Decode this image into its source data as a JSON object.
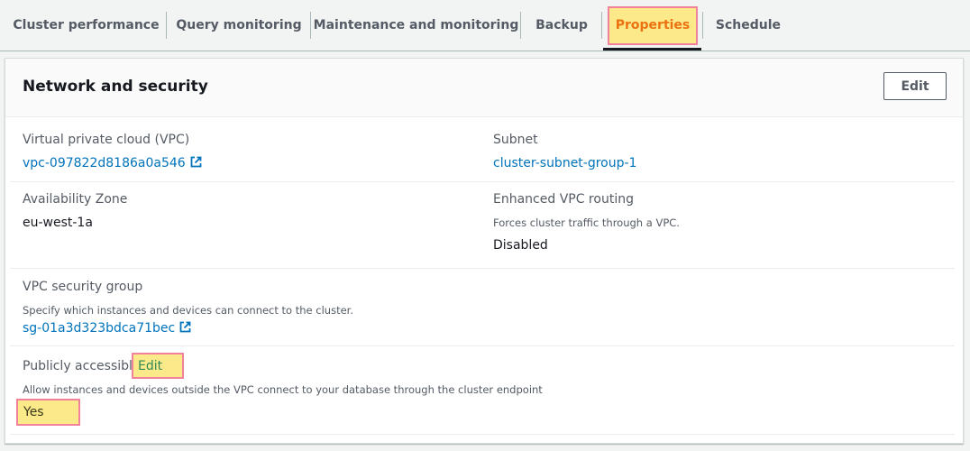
{
  "tabs": [
    {
      "label": "Cluster performance"
    },
    {
      "label": "Query monitoring"
    },
    {
      "label": "Maintenance and monitoring"
    },
    {
      "label": "Backup"
    },
    {
      "label": "Properties",
      "active": true
    },
    {
      "label": "Schedule"
    }
  ],
  "section": {
    "title": "Network and security",
    "edit_label": "Edit"
  },
  "fields": {
    "vpc": {
      "label": "Virtual private cloud (VPC)",
      "value": "vpc-097822d8186a0a546",
      "icon": "external-link-icon"
    },
    "subnet": {
      "label": "Subnet",
      "value": "cluster-subnet-group-1"
    },
    "az": {
      "label": "Availability Zone",
      "value": "eu-west-1a"
    },
    "enhanced_vpc": {
      "label": "Enhanced VPC routing",
      "description": "Forces cluster traffic through a VPC.",
      "value": "Disabled"
    },
    "security_group": {
      "label": "VPC security group",
      "description": "Specify which instances and devices can connect to the cluster.",
      "value": "sg-01a3d323bdca71bec",
      "icon": "external-link-icon"
    },
    "public": {
      "label": "Publicly accessible",
      "edit_label": "Edit",
      "description": "Allow instances and devices outside the VPC connect to your database through the cluster endpoint",
      "value": "Yes"
    }
  },
  "colors": {
    "accent": "#ec7211",
    "link": "#0073bb",
    "highlight_fill": "#fbe98a",
    "highlight_border": "#f2829b"
  }
}
